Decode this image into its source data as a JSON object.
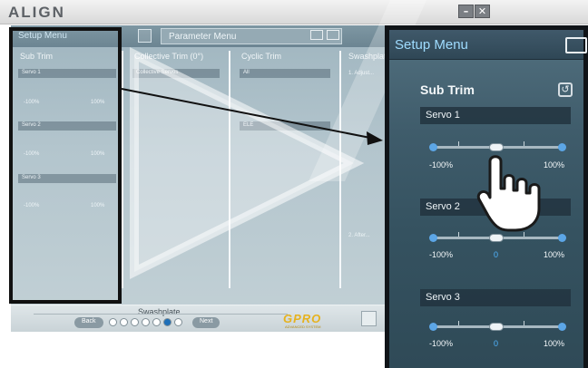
{
  "app": {
    "logo": "ALIGN",
    "window_min": "–",
    "window_close": "✕"
  },
  "background": {
    "menu_title": "Setup Menu",
    "parameter_menu": "Parameter Menu",
    "columns": [
      {
        "title": "Sub Trim",
        "servos": [
          "Servo 1",
          "Servo 2",
          "Servo 3"
        ]
      },
      {
        "title": "Collective Trim (0°)",
        "sub": "Collective Servos"
      },
      {
        "title": "Cyclic Trim",
        "sub": "All",
        "group": "ELE"
      },
      {
        "title": "Swashplate"
      }
    ],
    "notes": [
      "1. Adjust...",
      "2. After..."
    ],
    "bottom": {
      "label": "Swashplate",
      "back": "Back",
      "next": "Next",
      "page_count": 7,
      "active_page": 6,
      "brand": "GPRO",
      "brand_sub": "ADVANCED SYSTEM"
    }
  },
  "zoom": {
    "title": "Setup Menu",
    "section": "Sub Trim",
    "servos": [
      {
        "name": "Servo 1",
        "min": "-100%",
        "max": "100%",
        "value": "0"
      },
      {
        "name": "Servo 2",
        "min": "-100%",
        "max": "100%",
        "value": "0"
      },
      {
        "name": "Servo 3",
        "min": "-100%",
        "max": "100%",
        "value": "0"
      }
    ]
  },
  "icons": [
    "folder-icon",
    "reset-icon",
    "hand-pointer-icon",
    "play-watermark-icon",
    "arrow-icon"
  ],
  "colors": {
    "highlight_box": "#111111",
    "zoom_title": "#9fdcff",
    "slider_accent": "#5ca6e6",
    "active_dot": "#1e6fb8"
  }
}
